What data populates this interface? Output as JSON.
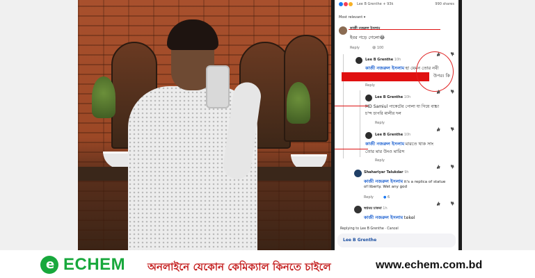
{
  "topbar": {
    "names": "Lee B Grenthe + 93k",
    "shares": "990 shares"
  },
  "sort": {
    "label": "Most relevant"
  },
  "comments": [
    {
      "name": "কাজী নজরুল ইসলাম",
      "text": "ইবর পড়ে গেলো😂",
      "time": "Reply",
      "reactions": "100"
    },
    {
      "name": "Lee B Grenthe",
      "time_short": "10h",
      "tag": "কাজী নজরুল ইসলাম",
      "text": "হা যেমন তোর নবী",
      "text2": "উপর। কি",
      "reply": "Reply"
    },
    {
      "name": "Lee B Grenthe",
      "time_short": "10h",
      "text": "MD Samiul পাকেটের পোলা যা গিয়ে বাচ্চা",
      "text2": "চ'ন্দ চাপরি মালীর দল",
      "reply": "Reply"
    },
    {
      "name": "Lee B Grenthe",
      "time_short": "10h",
      "tag": "কাজী নজরুল ইসলাম",
      "text": "মারতে থাক সাং",
      "text2": "তোর মার উংও মারিস",
      "reply": "Reply"
    },
    {
      "name": "Shahariyar Talukdar",
      "time_short": "9h",
      "tag": "কাজী নজরুল ইসলাম",
      "text": "it's a replica of statue",
      "text2": "of liberty. Wet any god",
      "reply": "Reply",
      "count": "6"
    },
    {
      "name": "স্বপ্নময় চাকমা",
      "time_short": "1h",
      "tag": "কাজী নজরুল ইসলাম",
      "text": "tekel",
      "reply": ""
    }
  ],
  "reply_to": "Replying to Lee B Grenthe · Cancel",
  "reply_input": "Lee B Grenthe",
  "banner": {
    "brand": "ECHEM",
    "text_bn": "অনলাইনে যেকোন কেমিক্যাল কিনতে চাইলে",
    "url": "www.echem.com.bd",
    "brand_color": "#18a83c",
    "text_color": "#c41e1e"
  }
}
